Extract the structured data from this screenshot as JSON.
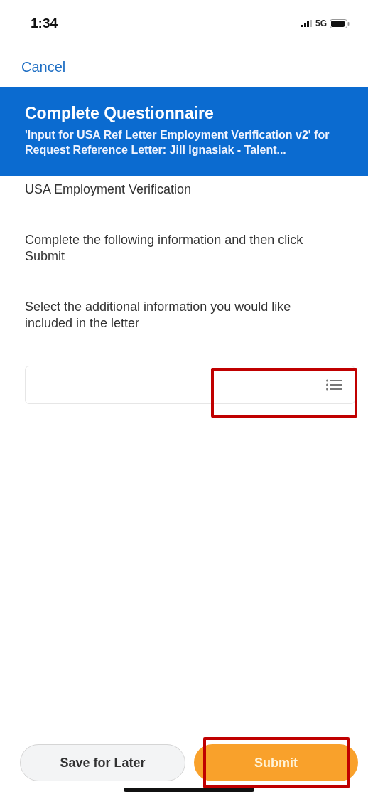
{
  "status_bar": {
    "time": "1:34",
    "network": "5G"
  },
  "nav": {
    "cancel": "Cancel"
  },
  "header": {
    "title": "Complete Questionnaire",
    "subtitle": "'Input for USA Ref Letter Employment Verification v2' for Request Reference Letter: Jill Ignasiak - Talent..."
  },
  "form": {
    "section_title": "USA Employment Verification",
    "paragraphs": [
      "Complete the following information and then click Submit",
      "Select the additional information you would like included in the letter"
    ],
    "field": {
      "kind": "list-select",
      "highlighted": true
    }
  },
  "buttons": [
    {
      "label": "Save for Later",
      "kind": "secondary",
      "highlighted": false
    },
    {
      "label": "Submit",
      "kind": "primary",
      "highlighted": true
    }
  ]
}
